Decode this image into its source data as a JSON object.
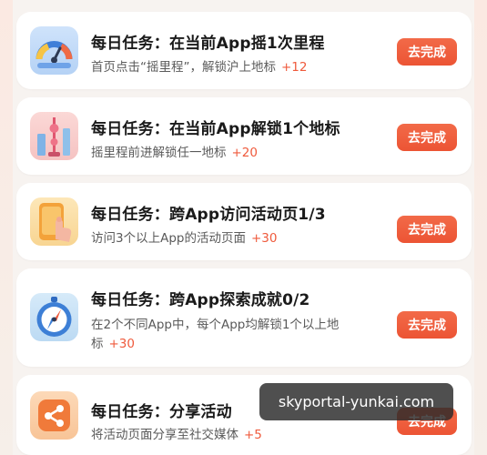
{
  "tasks": [
    {
      "title": "每日任务：在当前App摇1次里程",
      "desc": "首页点击“摇里程”，解锁沪上地标",
      "reward": "+12",
      "button": "去完成",
      "icon": "gauge-icon"
    },
    {
      "title": "每日任务：在当前App解锁1个地标",
      "desc": "摇里程前进解锁任一地标",
      "reward": "+20",
      "button": "去完成",
      "icon": "landmark-tower-icon"
    },
    {
      "title": "每日任务：跨App访问活动页1/3",
      "desc": "访问3个以上App的活动页面",
      "reward": "+30",
      "button": "去完成",
      "icon": "phone-tap-icon"
    },
    {
      "title": "每日任务：跨App探索成就0/2",
      "desc_line1": "在2个不同App中，每个App均解锁1个以上地",
      "desc_line2": "标",
      "reward": "+30",
      "button": "去完成",
      "icon": "compass-icon"
    },
    {
      "title": "每日任务：分享活动",
      "desc": "将活动页面分享至社交媒体",
      "reward": "+5",
      "button": "去完成",
      "icon": "share-icon"
    }
  ],
  "watermark": "skyportal-yunkai.com",
  "colors": {
    "accent": "#ef5a3c",
    "button": "#ec5434",
    "card": "#ffffff",
    "background": "#f7f3f0"
  }
}
